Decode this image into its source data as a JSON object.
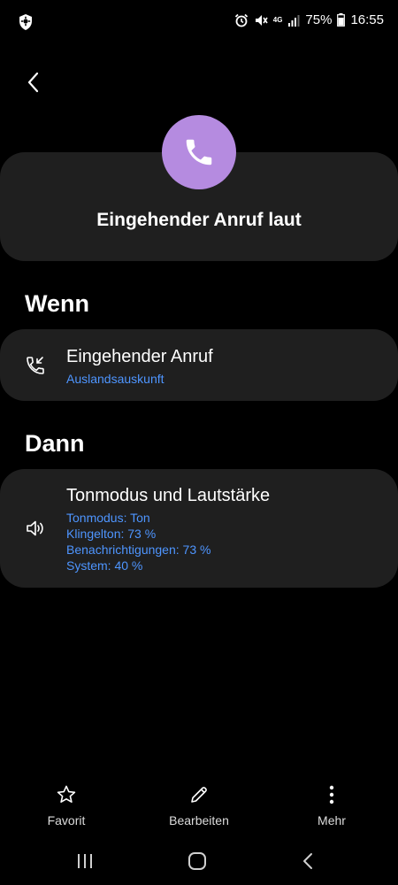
{
  "status_bar": {
    "battery": "75%",
    "time": "16:55",
    "network": "4G"
  },
  "header": {
    "title": "Eingehender Anruf laut",
    "icon": "phone-icon",
    "accent_color": "#b58be0"
  },
  "if_section": {
    "label": "Wenn",
    "card": {
      "icon": "incoming-call-icon",
      "title": "Eingehender Anruf",
      "subtitle": "Auslandsauskunft"
    }
  },
  "then_section": {
    "label": "Dann",
    "card": {
      "icon": "speaker-icon",
      "title": "Tonmodus und Lautstärke",
      "details": [
        "Tonmodus: Ton",
        "Klingelton: 73 %",
        "Benachrichtigungen: 73 %",
        "System: 40 %"
      ]
    }
  },
  "actions": {
    "favorite": "Favorit",
    "edit": "Bearbeiten",
    "more": "Mehr"
  },
  "colors": {
    "background": "#000000",
    "card": "#1f1f1f",
    "link": "#4e95ff"
  }
}
